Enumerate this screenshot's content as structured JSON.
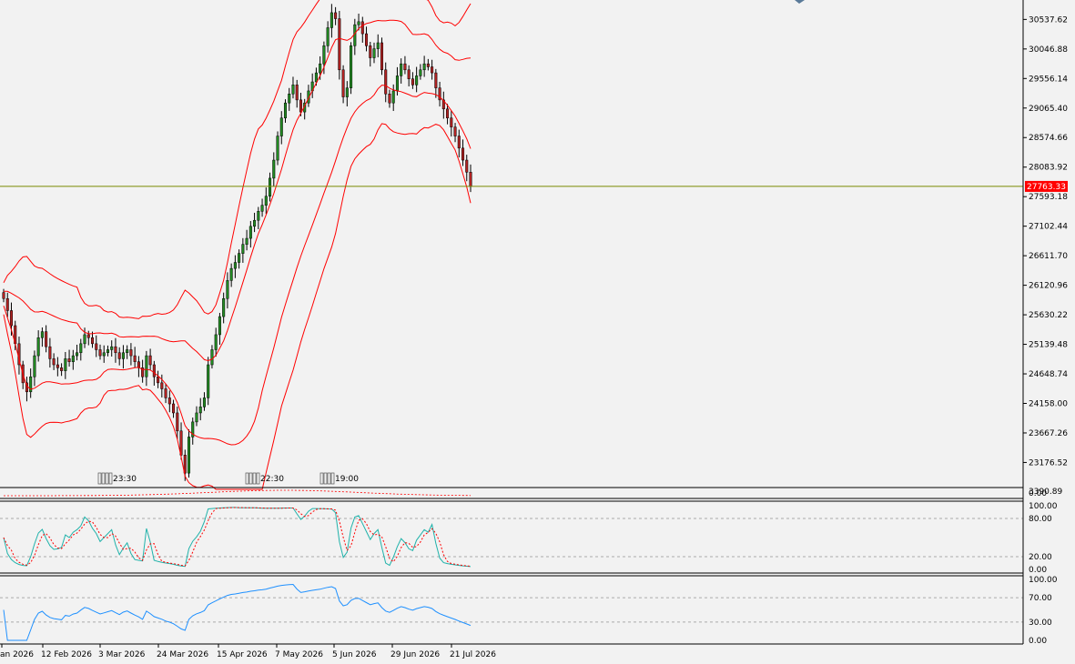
{
  "chart_data": [
    {
      "type": "candlestick",
      "panel": "price",
      "y_ticks": [
        "30537.62",
        "30046.88",
        "29556.14",
        "29065.40",
        "28574.66",
        "28083.92",
        "27593.18",
        "27102.44",
        "26611.70",
        "26120.96",
        "25630.22",
        "25139.48",
        "24648.74",
        "24158.00",
        "23667.26",
        "23176.52"
      ],
      "ylim": [
        22760,
        30800
      ],
      "current_price": 27763.33,
      "current_price_label": "27763.33",
      "x_labels": [
        "an 2026",
        "12 Feb 2026",
        "3 Mar 2026",
        "24 Mar 2026",
        "15 Apr 2026",
        "7 May 2026",
        "5 Jun 2026",
        "29 Jun 2026",
        "21 Jul 2026"
      ],
      "event_markers": [
        "23:30",
        "22:30",
        "19:00"
      ],
      "closes": [
        25900,
        25700,
        25450,
        25150,
        24800,
        24500,
        24350,
        24600,
        24950,
        25250,
        25350,
        25100,
        24900,
        24800,
        24750,
        24700,
        24900,
        24850,
        24950,
        25000,
        25150,
        25300,
        25250,
        25150,
        25050,
        24950,
        25000,
        25050,
        25100,
        25000,
        24900,
        25000,
        25050,
        24950,
        24850,
        24750,
        24600,
        24950,
        24800,
        24600,
        24500,
        24400,
        24250,
        24150,
        24000,
        23700,
        23300,
        23000,
        23600,
        23850,
        24000,
        24100,
        24250,
        24800,
        25050,
        25300,
        25600,
        25900,
        26200,
        26400,
        26500,
        26650,
        26800,
        26900,
        27100,
        27200,
        27350,
        27450,
        27600,
        27900,
        28200,
        28600,
        28900,
        29150,
        29300,
        29450,
        29200,
        29000,
        29150,
        29350,
        29500,
        29650,
        29800,
        30100,
        30400,
        30650,
        30550,
        29700,
        29250,
        29400,
        30100,
        30450,
        30500,
        30300,
        30100,
        29900,
        30050,
        30150,
        29700,
        29300,
        29150,
        29350,
        29600,
        29800,
        29700,
        29550,
        29450,
        29600,
        29700,
        29800,
        29750,
        29650,
        29400,
        29200,
        29050,
        28900,
        28750,
        28600,
        28400,
        28200,
        28000,
        27763
      ],
      "series": [
        {
          "name": "Bollinger",
          "color": "#ff0000"
        }
      ],
      "colors": {
        "bull": "#228b22",
        "bear": "#b22222",
        "price_line": "#7a8a00",
        "label_bg": "#ff0000"
      }
    },
    {
      "type": "line",
      "panel": "macd",
      "y_ticks": [
        "3390.89",
        "0.00"
      ]
    },
    {
      "type": "line",
      "panel": "stochastic",
      "y_ticks": [
        "100.00",
        "80.00",
        "20.00",
        "0.00"
      ],
      "ylim": [
        0,
        100
      ],
      "levels": [
        80,
        20
      ],
      "series": [
        {
          "color": "#20b2aa"
        },
        {
          "color": "#ff0000"
        }
      ]
    },
    {
      "type": "line",
      "panel": "rsi",
      "y_ticks": [
        "100.00",
        "70.00",
        "30.00",
        "0.00"
      ],
      "ylim": [
        0,
        100
      ],
      "levels": [
        70,
        30
      ],
      "series": [
        {
          "color": "#1e90ff"
        }
      ]
    }
  ]
}
